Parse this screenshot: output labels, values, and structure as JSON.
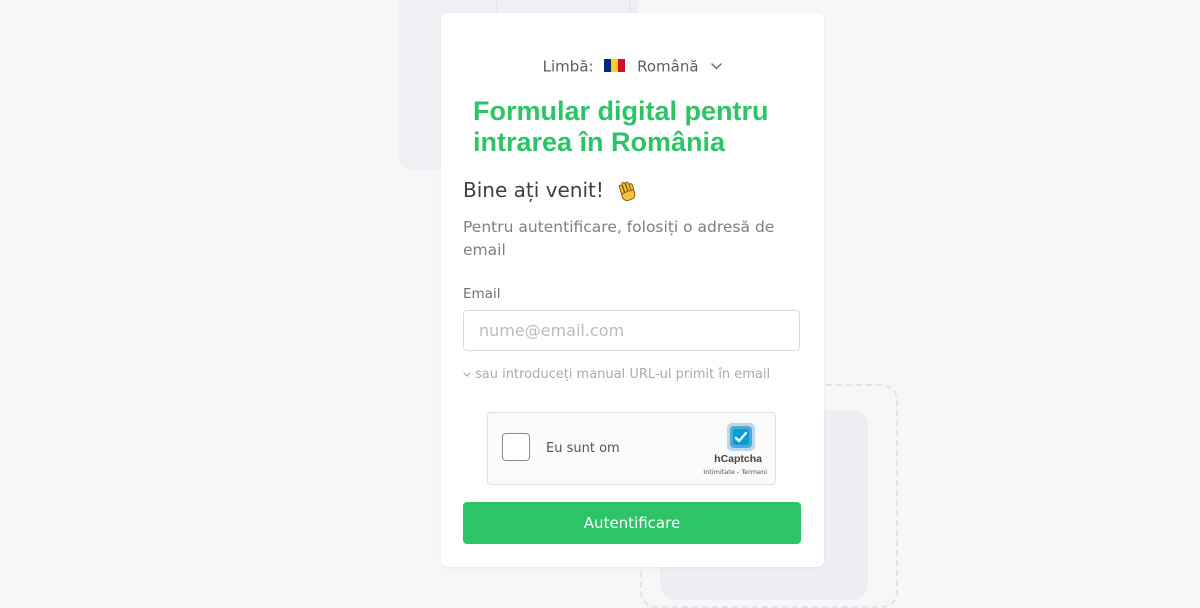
{
  "colors": {
    "accent": "#2dc468",
    "page_background": "#f7f7f8",
    "card_background": "#ffffff"
  },
  "language": {
    "label": "Limbă:",
    "flag_icon": "romania-flag-icon",
    "selected": "Română",
    "dropdown_icon": "chevron-down-icon"
  },
  "header": {
    "title": "Formular digital pentru\nintrarea în România"
  },
  "intro": {
    "welcome": "Bine ați venit!",
    "welcome_icon": "waving-hand-icon",
    "subtitle": "Pentru autentificare, folosiți o adresă de email"
  },
  "form": {
    "email_label": "Email",
    "email_value": "",
    "email_placeholder": "nume@email.com",
    "manual_url_link": "sau introduceți manual URL-ul primit în email"
  },
  "captcha": {
    "checkbox_label": "Eu sunt om",
    "brand": "hCaptcha",
    "terms": "Intimitate - Termeni",
    "logo_icon": "hcaptcha-logo-icon"
  },
  "actions": {
    "submit_label": "Autentificare"
  }
}
